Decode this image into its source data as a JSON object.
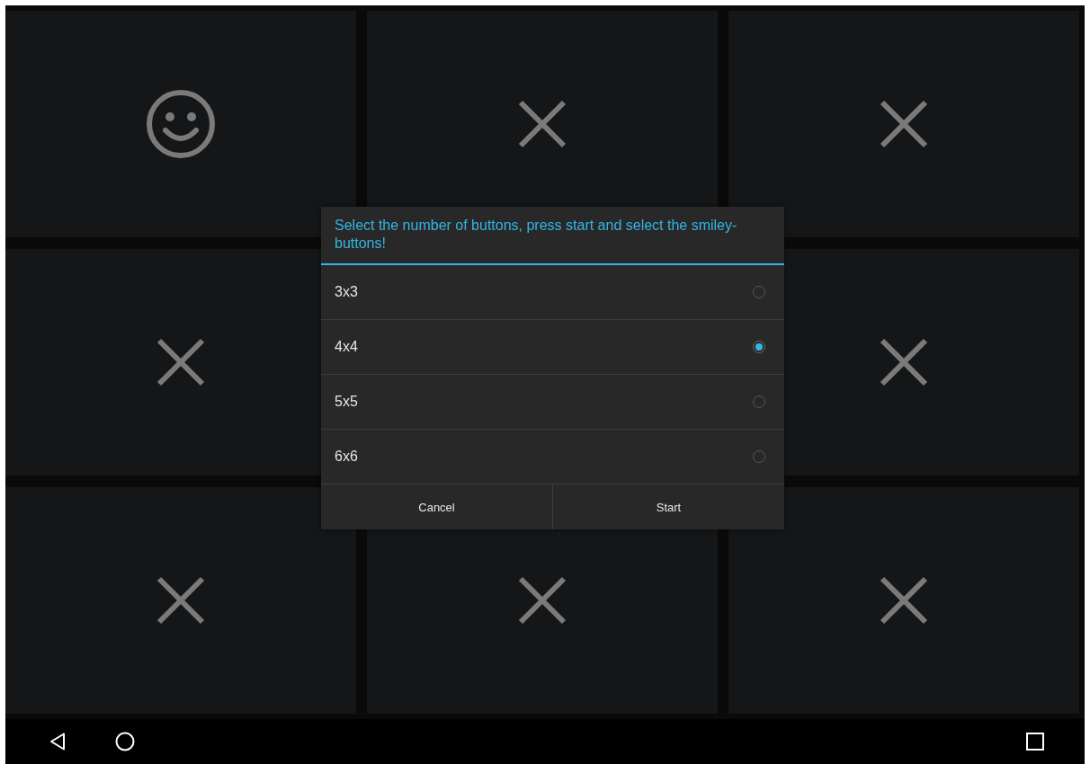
{
  "tiles": [
    {
      "kind": "smiley"
    },
    {
      "kind": "cross"
    },
    {
      "kind": "cross"
    },
    {
      "kind": "cross"
    },
    {
      "kind": "cross"
    },
    {
      "kind": "cross"
    },
    {
      "kind": "cross"
    },
    {
      "kind": "cross"
    }
  ],
  "dialog": {
    "title": "Select the number of buttons, press start and select the smiley-buttons!",
    "options": [
      {
        "label": "3x3",
        "selected": false
      },
      {
        "label": "4x4",
        "selected": true
      },
      {
        "label": "5x5",
        "selected": false
      },
      {
        "label": "6x6",
        "selected": false
      }
    ],
    "buttons": [
      "Cancel",
      "Start"
    ]
  },
  "nav_bar": [
    {
      "kind": "back"
    },
    {
      "kind": "home"
    },
    {
      "kind": "recents"
    }
  ]
}
